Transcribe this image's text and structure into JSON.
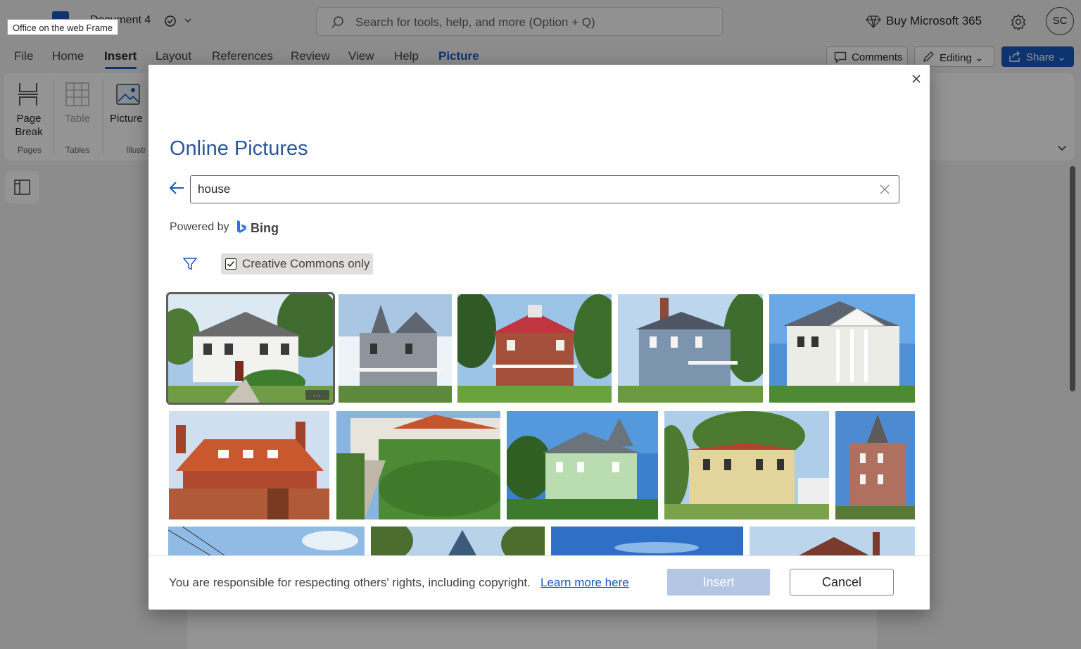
{
  "app": {
    "doc_title": "Document 4",
    "frame_tooltip": "Office on the web Frame",
    "search_placeholder": "Search for tools, help, and more (Option + Q)",
    "buy_label": "Buy Microsoft 365",
    "avatar_initials": "SC"
  },
  "menu": {
    "items": [
      "File",
      "Home",
      "Insert",
      "Layout",
      "References",
      "Review",
      "View",
      "Help",
      "Picture"
    ],
    "active": "Insert",
    "comments_label": "Comments",
    "editing_label": "Editing",
    "share_label": "Share"
  },
  "ribbon": {
    "page_break_label": "Page\nBreak",
    "table_label": "Table",
    "picture_label": "Picture",
    "groups": [
      "Pages",
      "Tables",
      "Illustr"
    ]
  },
  "dialog": {
    "title": "Online Pictures",
    "query": "house",
    "powered_by": "Powered by",
    "bing_label": "Bing",
    "cc_label": "Creative Commons only",
    "cc_checked": true,
    "rights_text": "You are responsible for respecting others' rights, including copyright.",
    "learn_more": "Learn more here",
    "insert_label": "Insert",
    "cancel_label": "Cancel",
    "more_label": "..."
  },
  "results": [
    {
      "name": "white-colonial-house",
      "row": 1,
      "selected": true
    },
    {
      "name": "gray-victorian-house",
      "row": 1
    },
    {
      "name": "red-brick-farmhouse",
      "row": 1
    },
    {
      "name": "blue-gray-italianate-house",
      "row": 1
    },
    {
      "name": "white-columned-house",
      "row": 1
    },
    {
      "name": "orange-tile-roof-house",
      "row": 2
    },
    {
      "name": "ivy-covered-villa",
      "row": 2
    },
    {
      "name": "green-victorian-house",
      "row": 2
    },
    {
      "name": "yellow-two-story-house",
      "row": 2
    },
    {
      "name": "brick-turret-house",
      "row": 2
    },
    {
      "name": "partial-sky-house-1",
      "row": 3
    },
    {
      "name": "partial-tower-house",
      "row": 3
    },
    {
      "name": "partial-blue-sky",
      "row": 3
    },
    {
      "name": "partial-roof-house",
      "row": 3
    }
  ],
  "colors": {
    "accent": "#185abd",
    "title": "#2b579a",
    "insert_disabled": "#b3c6e3"
  }
}
